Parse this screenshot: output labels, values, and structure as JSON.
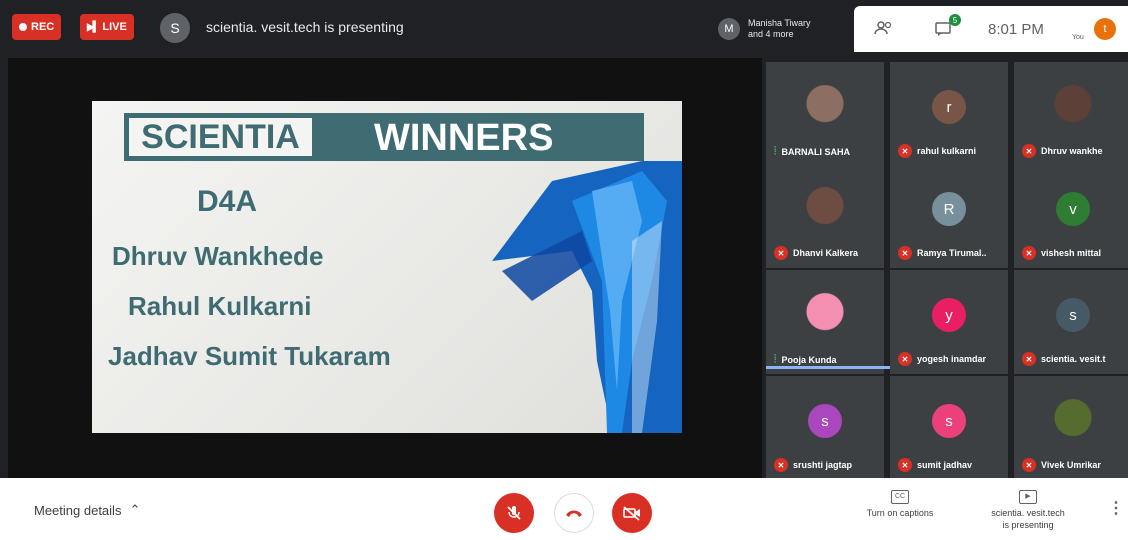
{
  "topbar": {
    "rec_label": "REC",
    "live_label": "LIVE",
    "presenter_initial": "S",
    "presenting_text": "scientia. vesit.tech is presenting",
    "people_initial": "M",
    "people_line1": "Manisha Tiwary",
    "people_line2": "and 4 more",
    "chat_badge": "5",
    "time": "8:01 PM",
    "you_label": "You",
    "you_initial": "t"
  },
  "slide": {
    "title_left": "SCIENTIA",
    "title_right": "WINNERS",
    "team": "D4A",
    "winners": [
      "Dhruv Wankhede",
      "Rahul Kulkarni",
      "Jadhav Sumit Tukaram"
    ]
  },
  "participants": [
    {
      "name": "BARNALI SAHA",
      "initial": "",
      "color": "#8d6e63",
      "mic": "on",
      "photo": true
    },
    {
      "name": "rahul kulkarni",
      "initial": "r",
      "color": "#795548",
      "mic": "off",
      "photo": false
    },
    {
      "name": "Dhruv wankhe",
      "initial": "",
      "color": "#5d4037",
      "mic": "off",
      "photo": true
    },
    {
      "name": "Dhanvi Kalkera",
      "initial": "",
      "color": "#6d4c41",
      "mic": "off",
      "photo": true
    },
    {
      "name": "Ramya Tirumal..",
      "initial": "R",
      "color": "#78909c",
      "mic": "off",
      "photo": false
    },
    {
      "name": "vishesh mittal",
      "initial": "v",
      "color": "#2e7d32",
      "mic": "off",
      "photo": false
    },
    {
      "name": "Pooja Kunda",
      "initial": "",
      "color": "#f48fb1",
      "mic": "on",
      "photo": true
    },
    {
      "name": "yogesh inamdar",
      "initial": "y",
      "color": "#e91e63",
      "mic": "off",
      "photo": false
    },
    {
      "name": "scientia. vesit.t",
      "initial": "s",
      "color": "#455a64",
      "mic": "off",
      "photo": false
    },
    {
      "name": "srushti jagtap",
      "initial": "s",
      "color": "#ab47bc",
      "mic": "off",
      "photo": false
    },
    {
      "name": "sumit jadhav",
      "initial": "s",
      "color": "#ec407a",
      "mic": "off",
      "photo": false
    },
    {
      "name": "Vivek Umrikar",
      "initial": "",
      "color": "#556b2f",
      "mic": "off",
      "photo": true
    }
  ],
  "bottombar": {
    "meeting_details": "Meeting details",
    "captions_label": "Turn on captions",
    "presenting_line1": "scientia. vesit.tech",
    "presenting_line2": "is presenting"
  },
  "colors": {
    "accent_red": "#d93025",
    "slide_teal": "#3f6b72",
    "active_speaker": "#8ab4f8"
  }
}
